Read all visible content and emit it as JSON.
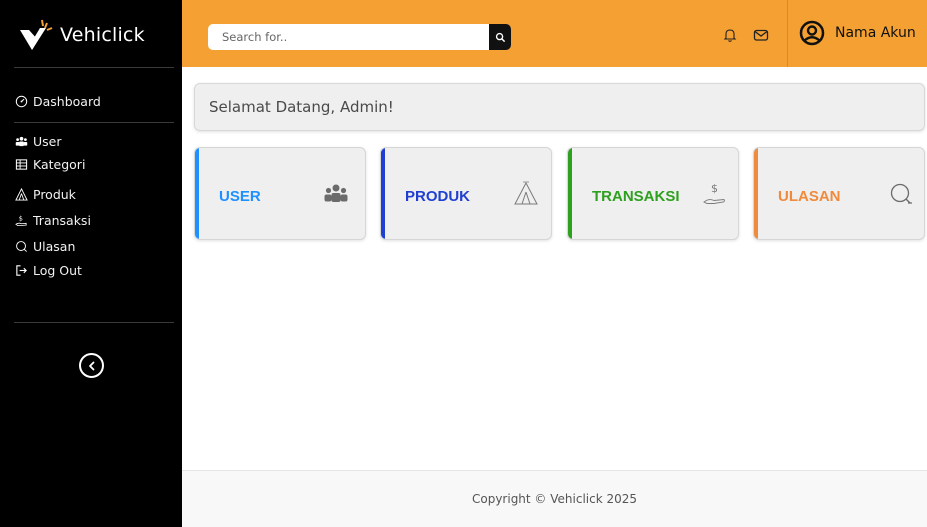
{
  "brand": {
    "name": "Vehiclick"
  },
  "sidebar": {
    "dashboard": "Dashboard",
    "items": [
      {
        "label": "User",
        "icon": "users-icon"
      },
      {
        "label": "Kategori",
        "icon": "table-icon"
      },
      {
        "label": "Produk",
        "icon": "tent-icon"
      },
      {
        "label": "Transaksi",
        "icon": "cash-hand-icon"
      },
      {
        "label": "Ulasan",
        "icon": "chat-icon"
      },
      {
        "label": "Log Out",
        "icon": "logout-icon"
      }
    ]
  },
  "topbar": {
    "search": {
      "placeholder": "Search for.."
    },
    "account_name": "Nama Akun"
  },
  "welcome": {
    "text": "Selamat Datang, Admin!"
  },
  "cards": [
    {
      "label": "USER",
      "color": "#1e90ff",
      "icon": "users-icon"
    },
    {
      "label": "PRODUK",
      "color": "#1f3fd1",
      "icon": "tent-icon"
    },
    {
      "label": "TRANSAKSI",
      "color": "#2ea01f",
      "icon": "cash-hand-icon"
    },
    {
      "label": "ULASAN",
      "color": "#f08a3c",
      "icon": "chat-icon"
    }
  ],
  "footer": {
    "text": "Copyright © Vehiclick 2025"
  },
  "colors": {
    "topbar": "#f4a032",
    "sidebar": "#000000"
  }
}
